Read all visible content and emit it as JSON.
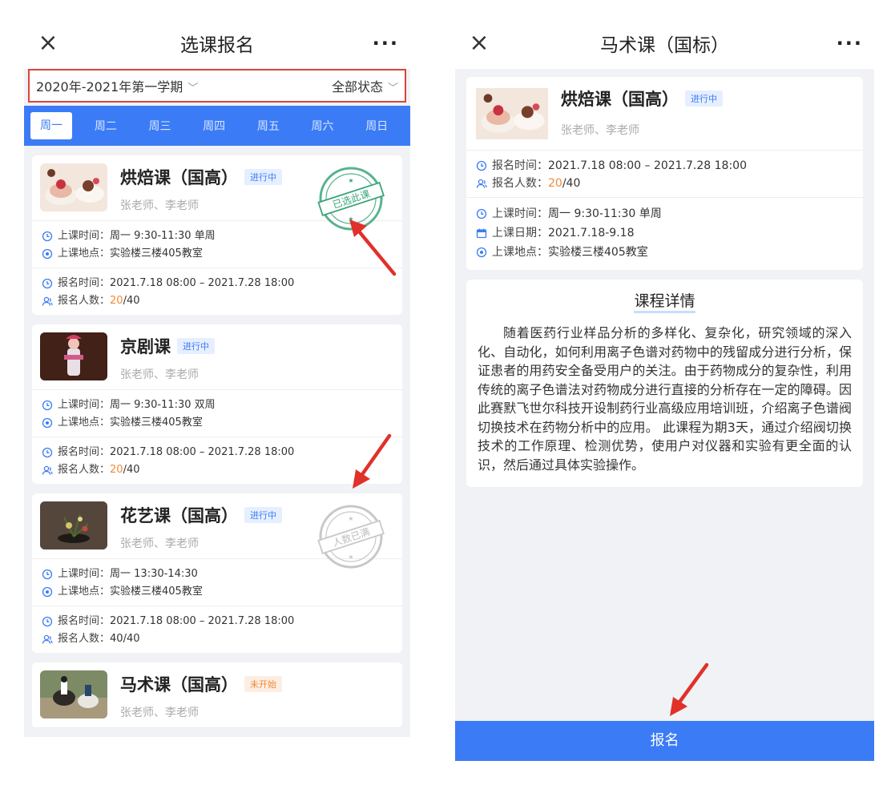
{
  "left": {
    "nav": {
      "close": "×",
      "title": "选课报名",
      "more": "···"
    },
    "filter": {
      "term": "2020年-2021年第一学期",
      "status": "全部状态"
    },
    "week": [
      "周一",
      "周二",
      "周三",
      "周四",
      "周五",
      "周六",
      "周日"
    ],
    "cards": [
      {
        "name": "烘焙课（国高）",
        "badge": "进行中",
        "teachers": "张老师、李老师",
        "time_label": "上课时间：",
        "time": "周一   9:30-11:30   单周",
        "place_label": "上课地点：",
        "place": "实验楼三楼405教室",
        "reg_label": "报名时间：",
        "reg": "2021.7.18 08:00 – 2021.7.28 18:00",
        "count_label": "报名人数：",
        "count_cur": "20",
        "count_total": "/40",
        "stamp": "已选此课"
      },
      {
        "name": "京剧课",
        "badge": "进行中",
        "teachers": "张老师、李老师",
        "time_label": "上课时间：",
        "time": "周一   9:30-11:30   双周",
        "place_label": "上课地点：",
        "place": "实验楼三楼405教室",
        "reg_label": "报名时间：",
        "reg": "2021.7.18 08:00 – 2021.7.28 18:00",
        "count_label": "报名人数：",
        "count_cur": "20",
        "count_total": "/40"
      },
      {
        "name": "花艺课（国高）",
        "badge": "进行中",
        "teachers": "张老师、李老师",
        "time_label": "上课时间：",
        "time": "周一   13:30-14:30",
        "place_label": "上课地点：",
        "place": "实验楼三楼405教室",
        "reg_label": "报名时间：",
        "reg": "2021.7.18 08:00 – 2021.7.28 18:00",
        "count_label": "报名人数：",
        "count_cur": "40",
        "count_total": "/40",
        "stamp": "人数已满"
      },
      {
        "name": "马术课（国高）",
        "badge": "未开始",
        "teachers": "张老师、李老师"
      }
    ]
  },
  "right": {
    "nav": {
      "close": "×",
      "title": "马术课（国标）",
      "more": "···"
    },
    "card": {
      "name": "烘焙课（国高）",
      "badge": "进行中",
      "teachers": "张老师、李老师",
      "reg_label": "报名时间：",
      "reg": "2021.7.18 08:00 – 2021.7.28 18:00",
      "count_label": "报名人数：",
      "count_cur": "20",
      "count_total": "/40",
      "time_label": "上课时间：",
      "time": "周一   9:30-11:30   单周",
      "date_label": "上课日期：",
      "date": "2021.7.18-9.18",
      "place_label": "上课地点：",
      "place": "实验楼三楼405教室"
    },
    "detail": {
      "title": "课程详情",
      "body": "随着医药行业样品分析的多样化、复杂化，研究领域的深入化、自动化，如何利用离子色谱对药物中的残留成分进行分析，保证患者的用药安全备受用户的关注。由于药物成分的复杂性，利用传统的离子色谱法对药物成分进行直接的分析存在一定的障碍。因此赛默飞世尔科技开设制药行业高级应用培训班，介绍离子色谱阀切换技术在药物分析中的应用。 此课程为期3天，通过介绍阀切换技术的工作原理、检测优势，使用户对仪器和实验有更全面的认识，然后通过具体实验操作。"
    },
    "signup": "报名"
  },
  "colors": {
    "accent": "#3b7cf6",
    "highlight": "#f08a3b",
    "annotation": "#e0312a",
    "stamp_green": "#3aa57a",
    "stamp_gray": "#c8c8c8"
  }
}
